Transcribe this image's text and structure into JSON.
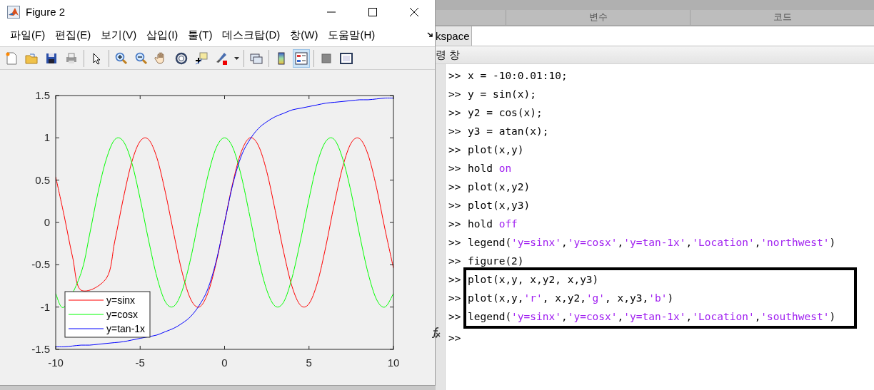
{
  "figure_window": {
    "title": "Figure 2",
    "menu": [
      "파일(F)",
      "편집(E)",
      "보기(V)",
      "삽입(I)",
      "툴(T)",
      "데스크탑(D)",
      "창(W)",
      "도움말(H)"
    ],
    "toolbar": [
      {
        "pressed": false
      },
      {
        "pressed": false
      },
      {
        "pressed": false
      },
      {
        "pressed": false
      },
      {
        "pressed": false
      },
      {
        "pressed": false
      },
      {
        "pressed": false
      },
      {
        "pressed": false
      },
      {
        "pressed": false
      },
      {
        "pressed": false
      },
      {
        "pressed": false
      },
      {
        "pressed": false
      },
      {
        "pressed": false
      },
      {
        "pressed": false
      },
      {
        "pressed": true
      },
      {
        "pressed": false
      },
      {
        "pressed": false
      }
    ],
    "chart_data": {
      "type": "line",
      "x": [
        -10,
        -9.5,
        -9,
        -8.5,
        -8,
        -7.5,
        -7,
        -6.5,
        -6,
        -5.5,
        -5,
        -4.5,
        -4,
        -3.5,
        -3,
        -2.5,
        -2,
        -1.5,
        -1,
        -0.5,
        0,
        0.5,
        1,
        1.5,
        2,
        2.5,
        3,
        3.5,
        4,
        4.5,
        5,
        5.5,
        6,
        6.5,
        7,
        7.5,
        8,
        8.5,
        9,
        9.5,
        10
      ],
      "series": [
        {
          "name": "y=sinx",
          "color": "#ff0000",
          "values": [
            0.54,
            0.08,
            -0.41,
            -0.8,
            null,
            null,
            -0.66,
            -0.22,
            0.28,
            0.71,
            0.96,
            0.98,
            0.76,
            0.35,
            -0.14,
            -0.6,
            -0.91,
            -1,
            -0.84,
            -0.48,
            0,
            0.48,
            0.84,
            1,
            0.91,
            0.6,
            0.14,
            -0.35,
            -0.76,
            -0.98,
            -0.96,
            -0.71,
            -0.28,
            0.22,
            0.66,
            0.94,
            0.99,
            0.8,
            0.41,
            -0.08,
            -0.54
          ]
        },
        {
          "name": "y=cosx",
          "color": "#00ff00",
          "values": [
            -0.84,
            -1,
            null,
            -0.6,
            -0.15,
            0.35,
            0.75,
            0.98,
            0.96,
            0.71,
            0.28,
            -0.21,
            -0.65,
            -0.94,
            -0.99,
            -0.8,
            -0.42,
            0.07,
            0.54,
            0.88,
            1,
            0.88,
            0.54,
            0.07,
            -0.42,
            -0.8,
            -0.99,
            -0.94,
            -0.65,
            -0.21,
            0.28,
            0.71,
            0.96,
            0.98,
            0.75,
            0.35,
            -0.15,
            -0.6,
            -0.91,
            -1,
            -0.84
          ]
        },
        {
          "name": "y=tan-1x",
          "color": "#0000ff",
          "values": [
            -1.47,
            -1.47,
            -1.46,
            -1.45,
            -1.45,
            -1.44,
            -1.43,
            -1.42,
            -1.41,
            -1.39,
            -1.37,
            -1.35,
            -1.33,
            -1.29,
            -1.25,
            -1.19,
            -1.11,
            -0.98,
            -0.79,
            -0.46,
            0,
            0.46,
            0.79,
            0.98,
            1.11,
            1.19,
            1.25,
            1.29,
            1.33,
            1.35,
            1.37,
            1.39,
            1.41,
            1.42,
            1.43,
            1.44,
            1.45,
            1.45,
            1.46,
            1.47,
            1.47
          ]
        }
      ],
      "legend": "lower left",
      "xlim": [
        -10,
        10
      ],
      "ylim": [
        -1.5,
        1.5
      ],
      "xticks": [
        -10,
        -5,
        0,
        5,
        10
      ],
      "yticks": [
        -1.5,
        -1,
        -0.5,
        0,
        0.5,
        1,
        1.5
      ]
    }
  },
  "ribbon": {
    "sections": [
      "변수",
      "코드"
    ]
  },
  "workspace_tab": "kspace",
  "command_window": {
    "title": "령 창",
    "lines": [
      {
        "prompt": ">>",
        "highlighted": false,
        "segments": [
          {
            "kind": "code",
            "text": "x = -10:0.01:10;"
          }
        ]
      },
      {
        "prompt": ">>",
        "highlighted": false,
        "segments": [
          {
            "kind": "code",
            "text": "y = sin(x);"
          }
        ]
      },
      {
        "prompt": ">>",
        "highlighted": false,
        "segments": [
          {
            "kind": "code",
            "text": "y2 = cos(x);"
          }
        ]
      },
      {
        "prompt": ">>",
        "highlighted": false,
        "segments": [
          {
            "kind": "code",
            "text": "y3 = atan(x);"
          }
        ]
      },
      {
        "prompt": ">>",
        "highlighted": false,
        "segments": [
          {
            "kind": "code",
            "text": "plot(x,y)"
          }
        ]
      },
      {
        "prompt": ">>",
        "highlighted": false,
        "segments": [
          {
            "kind": "code",
            "text": "hold "
          },
          {
            "kind": "string",
            "text": "on"
          }
        ]
      },
      {
        "prompt": ">>",
        "highlighted": false,
        "segments": [
          {
            "kind": "code",
            "text": "plot(x,y2)"
          }
        ]
      },
      {
        "prompt": ">>",
        "highlighted": false,
        "segments": [
          {
            "kind": "code",
            "text": "plot(x,y3)"
          }
        ]
      },
      {
        "prompt": ">>",
        "highlighted": false,
        "segments": [
          {
            "kind": "code",
            "text": "hold "
          },
          {
            "kind": "string",
            "text": "off"
          }
        ]
      },
      {
        "prompt": ">>",
        "highlighted": false,
        "segments": [
          {
            "kind": "code",
            "text": "legend("
          },
          {
            "kind": "string",
            "text": "'y=sinx'"
          },
          {
            "kind": "code",
            "text": ","
          },
          {
            "kind": "string",
            "text": "'y=cosx'"
          },
          {
            "kind": "code",
            "text": ","
          },
          {
            "kind": "string",
            "text": "'y=tan-1x'"
          },
          {
            "kind": "code",
            "text": ","
          },
          {
            "kind": "string",
            "text": "'Location'"
          },
          {
            "kind": "code",
            "text": ","
          },
          {
            "kind": "string",
            "text": "'northwest'"
          },
          {
            "kind": "code",
            "text": ")"
          }
        ]
      },
      {
        "prompt": ">>",
        "highlighted": false,
        "segments": [
          {
            "kind": "code",
            "text": "figure(2)"
          }
        ]
      },
      {
        "prompt": ">>",
        "highlighted": true,
        "segments": [
          {
            "kind": "code",
            "text": "plot(x,y, x,y2, x,y3)"
          }
        ]
      },
      {
        "prompt": ">>",
        "highlighted": true,
        "segments": [
          {
            "kind": "code",
            "text": "plot(x,y,"
          },
          {
            "kind": "string",
            "text": "'r'"
          },
          {
            "kind": "code",
            "text": ", x,y2,"
          },
          {
            "kind": "string",
            "text": "'g'"
          },
          {
            "kind": "code",
            "text": ", x,y3,"
          },
          {
            "kind": "string",
            "text": "'b'"
          },
          {
            "kind": "code",
            "text": ")"
          }
        ]
      },
      {
        "prompt": ">>",
        "highlighted": true,
        "segments": [
          {
            "kind": "code",
            "text": "legend("
          },
          {
            "kind": "string",
            "text": "'y=sinx'"
          },
          {
            "kind": "code",
            "text": ","
          },
          {
            "kind": "string",
            "text": "'y=cosx'"
          },
          {
            "kind": "code",
            "text": ","
          },
          {
            "kind": "string",
            "text": "'y=tan-1x'"
          },
          {
            "kind": "code",
            "text": ","
          },
          {
            "kind": "string",
            "text": "'Location'"
          },
          {
            "kind": "code",
            "text": ","
          },
          {
            "kind": "string",
            "text": "'southwest'"
          },
          {
            "kind": "code",
            "text": ")"
          }
        ]
      }
    ],
    "input_prompt": ">>"
  }
}
